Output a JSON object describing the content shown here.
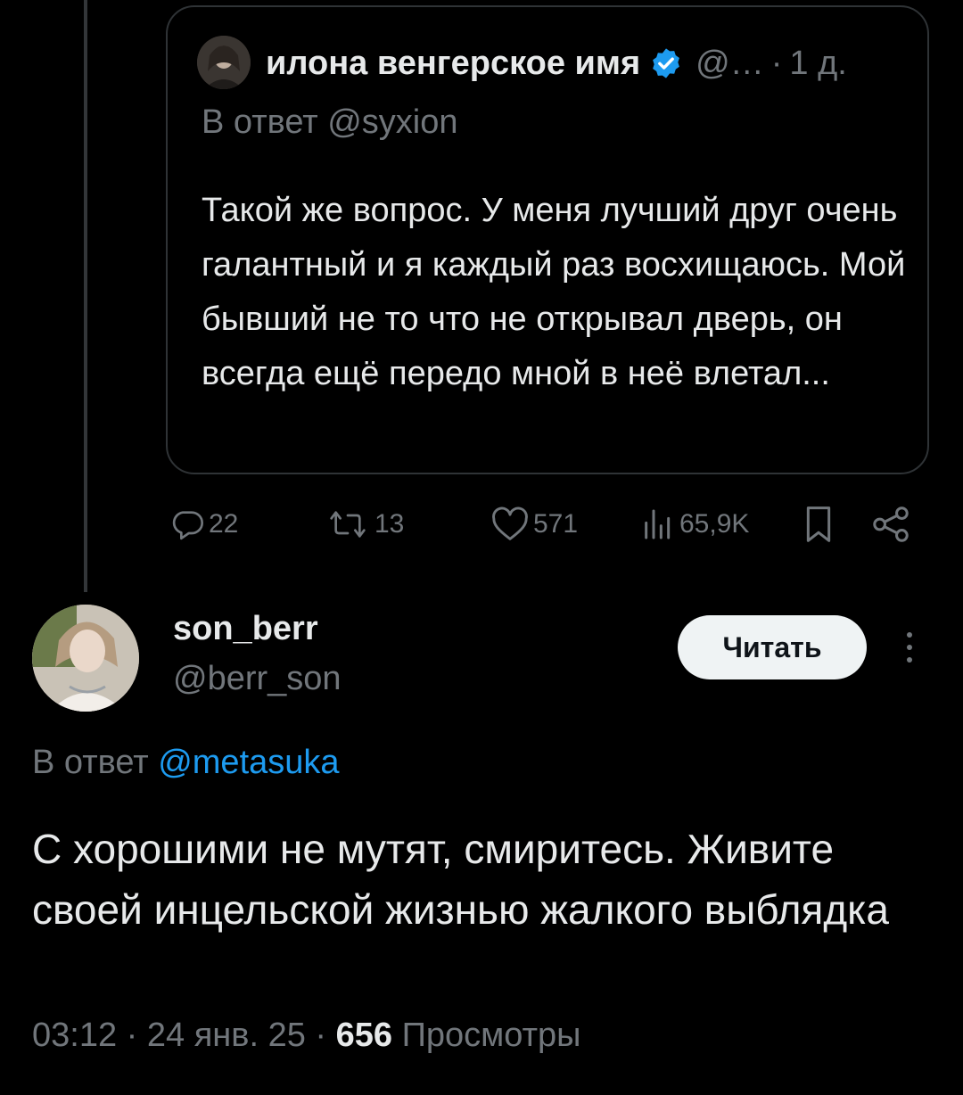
{
  "quoted_tweet": {
    "author_name": "илона венгерское имя",
    "author_handle": "@…",
    "dot": "·",
    "time": "1 д.",
    "reply_to": "В ответ @syxion",
    "text": "Такой же вопрос. У меня лучший друг очень галантный и я каждый раз восхищаюсь. Мой бывший не то что не открывал дверь, он всегда ещё передо мной в неё влетал..."
  },
  "actions": {
    "replies": "22",
    "retweets": "13",
    "likes": "571",
    "views": "65,9K"
  },
  "main_tweet": {
    "author_name": "son_berr",
    "author_handle": "@berr_son",
    "follow_label": "Читать",
    "reply_prefix": "В ответ ",
    "reply_mention": "@metasuka",
    "text": "С хорошими не мутят, смиритесь. Живите своей инцельской жизнью жалкого выблядка",
    "time": "03:12",
    "dot": " · ",
    "date": "24 янв. 25",
    "views_count": "656",
    "views_label": "Просмотры"
  },
  "icons": {
    "verified": "verified-badge-icon",
    "reply": "reply-icon",
    "retweet": "retweet-icon",
    "like": "heart-icon",
    "views": "views-chart-icon",
    "bookmark": "bookmark-icon",
    "share": "share-icon",
    "more": "more-vertical-icon"
  },
  "colors": {
    "background": "#000000",
    "text_primary": "#e7e9ea",
    "text_secondary": "#71767b",
    "accent": "#1d9bf0",
    "border": "#2f3336",
    "button_bg": "#eff3f4"
  }
}
